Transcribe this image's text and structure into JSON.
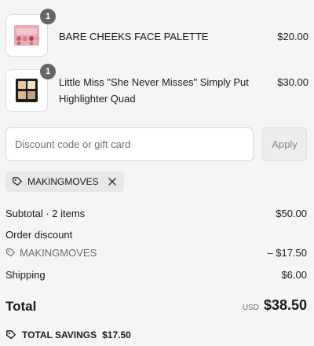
{
  "items": [
    {
      "name": "BARE CHEEKS FACE PALETTE",
      "price": "$20.00",
      "quantity": "1"
    },
    {
      "name": "Little Miss \"She Never Misses\" Simply Put",
      "name_line2": "Highlighter Quad",
      "price": "$30.00",
      "quantity": "1"
    }
  ],
  "discount": {
    "placeholder": "Discount code or gift card",
    "value": "",
    "apply_label": "Apply"
  },
  "applied_code": {
    "code": "MAKINGMOVES"
  },
  "summary": {
    "subtotal_label": "Subtotal · 2 items",
    "subtotal_value": "$50.00",
    "order_discount_label": "Order discount",
    "discount_code": "MAKINGMOVES",
    "discount_value": "– $17.50",
    "shipping_label": "Shipping",
    "shipping_value": "$6.00",
    "total_label": "Total",
    "currency": "USD",
    "total_value": "$38.50",
    "savings_label": "TOTAL SAVINGS",
    "savings_value": "$17.50"
  }
}
